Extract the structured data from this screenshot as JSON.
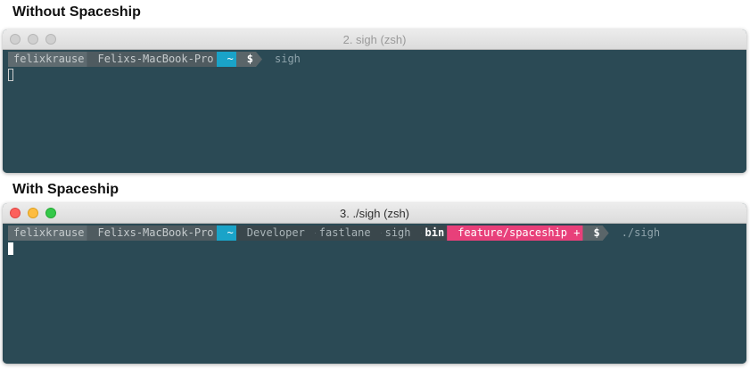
{
  "headings": {
    "without": "Without Spaceship",
    "with": "With Spaceship"
  },
  "window1": {
    "title": "2. sigh (zsh)",
    "prompt": {
      "user": "felixkrause",
      "host": "Felixs-MacBook-Pro",
      "dir": "~",
      "symbol": "$"
    },
    "command": "sigh",
    "traffic_lights": "inactive"
  },
  "window2": {
    "title": "3. ./sigh (zsh)",
    "prompt": {
      "user": "felixkrause",
      "host": "Felixs-MacBook-Pro",
      "dir": "~",
      "path": [
        "Developer",
        "fastlane",
        "sigh",
        "bin"
      ],
      "branch": "feature/spaceship +",
      "symbol": "$"
    },
    "command": "./sigh",
    "traffic_lights": "active"
  },
  "colors": {
    "terminal_bg": "#2b4a55",
    "dir_segment": "#1aa3c8",
    "git_branch": "#e8407a",
    "close": "#fc605c",
    "minimize": "#fdbc40",
    "zoom": "#34c84a"
  }
}
